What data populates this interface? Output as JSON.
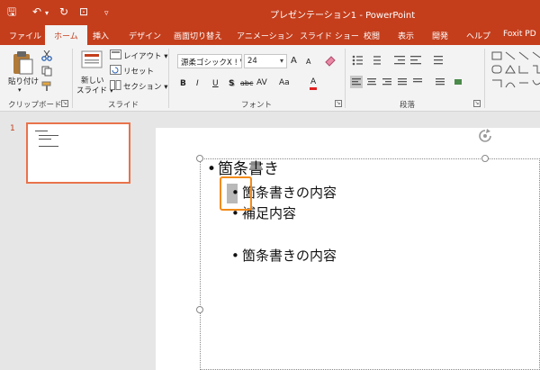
{
  "titlebar": {
    "title": "プレゼンテーション1  -  PowerPoint",
    "qa_save": "🖫",
    "qa_undo": "↶",
    "qa_undo_drop": "▾",
    "qa_redo": "↻",
    "qa_start": "⊡",
    "qa_customize": "▿"
  },
  "tabs": [
    "ファイル",
    "ホーム",
    "挿入",
    "デザイン",
    "画面切り替え",
    "アニメーション",
    "スライド ショー",
    "校閲",
    "表示",
    "開発",
    "ヘルプ",
    "Foxit PD"
  ],
  "active_tab": "ホーム",
  "ribbon": {
    "clipboard": {
      "paste": "貼り付け",
      "paste_arrow": "▾",
      "label": "クリップボード"
    },
    "slides": {
      "new_slide_line1": "新しい",
      "new_slide_line2": "スライド ▾",
      "layout": "レイアウト ▾",
      "reset": "リセット",
      "section": "セクション ▾",
      "label": "スライド"
    },
    "font": {
      "name": "源柔ゴシックX ! V",
      "size": "24",
      "grow": "A",
      "shrink": "A",
      "bold": "B",
      "italic": "I",
      "underline": "U",
      "shadow": "S",
      "strike": "abc",
      "spacing": "AV",
      "case": "Aa",
      "color": "A",
      "label": "フォント"
    },
    "paragraph": {
      "label": "段落"
    }
  },
  "thumbnail": {
    "number": "1"
  },
  "slide": {
    "bullets": [
      {
        "text": "箇条書き",
        "level": 1
      },
      {
        "text": "箇条書きの内容",
        "level": 2
      },
      {
        "text": "補足内容",
        "level": 2
      },
      {
        "text": "箇条書きの内容",
        "level": 2
      }
    ],
    "bullet_char": "•"
  },
  "colors": {
    "accent": "#c43e1c",
    "focus_outline": "#f28b1a",
    "thumb_border": "#e8734a"
  }
}
